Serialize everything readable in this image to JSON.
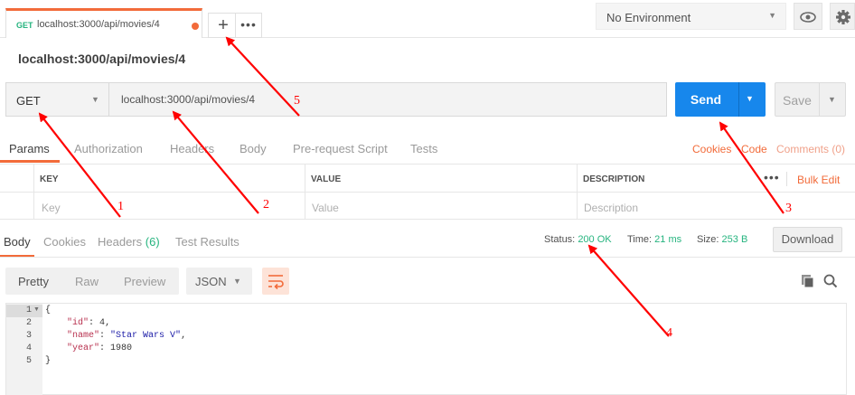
{
  "tab": {
    "method": "GET",
    "title": "localhost:3000/api/movies/4",
    "plus": "+",
    "more": "•••"
  },
  "environment": {
    "selected": "No Environment"
  },
  "request": {
    "name": "localhost:3000/api/movies/4",
    "method": "GET",
    "url": "localhost:3000/api/movies/4",
    "send_label": "Send",
    "save_label": "Save"
  },
  "request_tabs": [
    "Params",
    "Authorization",
    "Headers",
    "Body",
    "Pre-request Script",
    "Tests"
  ],
  "request_links": {
    "cookies": "Cookies",
    "code": "Code",
    "comments": "Comments (0)"
  },
  "params_table": {
    "headers": [
      "KEY",
      "VALUE",
      "DESCRIPTION"
    ],
    "placeholders": [
      "Key",
      "Value",
      "Description"
    ],
    "more": "•••",
    "bulk_edit": "Bulk Edit"
  },
  "response": {
    "tabs": [
      "Body",
      "Cookies",
      "Headers",
      "(6)",
      "Test Results"
    ],
    "status_label": "Status:",
    "status_value": "200 OK",
    "time_label": "Time:",
    "time_value": "21 ms",
    "size_label": "Size:",
    "size_value": "253 B",
    "download_label": "Download",
    "views": [
      "Pretty",
      "Raw",
      "Preview"
    ],
    "language": "JSON"
  },
  "code": {
    "line_numbers": [
      "1",
      "2",
      "3",
      "4",
      "5"
    ],
    "open_brace": "{",
    "close_brace": "}",
    "id_key": "\"id\"",
    "id_value": "4",
    "name_key": "\"name\"",
    "name_value": "\"Star Wars V\"",
    "year_key": "\"year\"",
    "year_value": "1980"
  },
  "annotations": [
    "1",
    "2",
    "3",
    "4",
    "5"
  ],
  "colors": {
    "accent": "#f26b3a",
    "send": "#1787ec",
    "success": "#26b47f",
    "annotation": "#ff0000"
  }
}
